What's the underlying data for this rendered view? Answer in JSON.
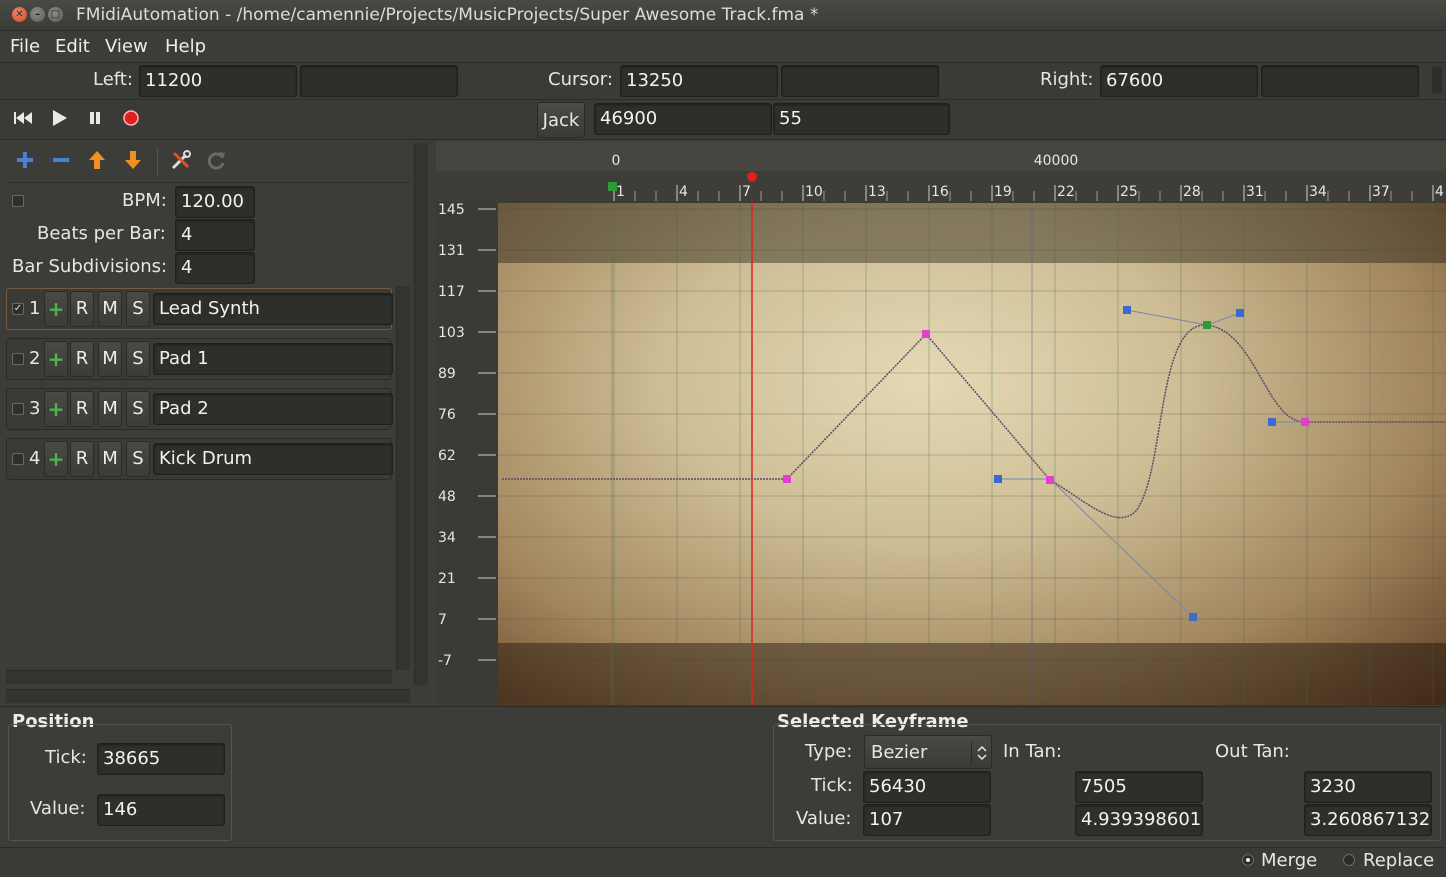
{
  "window": {
    "title": "FMidiAutomation - /home/camennie/Projects/MusicProjects/Super Awesome Track.fma *",
    "close_glyph": "✕",
    "min_glyph": "–",
    "max_glyph": "□"
  },
  "menu": [
    "File",
    "Edit",
    "View",
    "Help"
  ],
  "position_bar": {
    "left_label": "Left:",
    "left_value": "11200",
    "left_extra": "",
    "cursor_label": "Cursor:",
    "cursor_value": "13250",
    "cursor_extra": "",
    "right_label": "Right:",
    "right_value": "67600",
    "right_extra": ""
  },
  "transport": {
    "icons": [
      "rewind-icon",
      "play-icon",
      "pause-icon",
      "record-icon"
    ],
    "jack_label": "Jack",
    "jack_value1": "46900",
    "jack_value2": "55"
  },
  "toolbar_icons": [
    "add-icon",
    "remove-icon",
    "move-up-icon",
    "move-down-icon",
    "tools-icon",
    "redo-icon"
  ],
  "tempo": {
    "bpm_label": "BPM:",
    "bpm_value": "120.00",
    "beats_label": "Beats per Bar:",
    "beats_value": "4",
    "subdiv_label": "Bar Subdivisions:",
    "subdiv_value": "4"
  },
  "tracks": [
    {
      "num": "1",
      "r": "R",
      "m": "M",
      "s": "S",
      "name": "Lead Synth",
      "checked": true
    },
    {
      "num": "2",
      "r": "R",
      "m": "M",
      "s": "S",
      "name": "Pad 1",
      "checked": false
    },
    {
      "num": "3",
      "r": "R",
      "m": "M",
      "s": "S",
      "name": "Pad 2",
      "checked": false
    },
    {
      "num": "4",
      "r": "R",
      "m": "M",
      "s": "S",
      "name": "Kick Drum",
      "checked": false
    }
  ],
  "timeline": {
    "tick_labels_top": [
      "0",
      "40000"
    ],
    "bar_labels": [
      "1",
      "4",
      "7",
      "10",
      "13",
      "16",
      "19",
      "22",
      "25",
      "28",
      "31",
      "34",
      "37",
      "4"
    ],
    "value_labels": [
      "145",
      "131",
      "117",
      "103",
      "89",
      "76",
      "62",
      "48",
      "34",
      "21",
      "7",
      "-7"
    ]
  },
  "position_panel": {
    "title": "Position",
    "tick_label": "Tick:",
    "tick_value": "38665",
    "value_label": "Value:",
    "value_value": "146"
  },
  "keyframe_panel": {
    "title": "Selected Keyframe",
    "type_label": "Type:",
    "type_value": "Bezier",
    "in_tan_label": "In Tan:",
    "out_tan_label": "Out Tan:",
    "tick_label": "Tick:",
    "tick_value": "56430",
    "value_label": "Value:",
    "value_value": "107",
    "in_tick": "7505",
    "in_value": "4.939398601",
    "out_tick": "3230",
    "out_value": "3.260867132"
  },
  "status": {
    "merge_label": "Merge",
    "replace_label": "Replace",
    "selected_mode": "Merge"
  },
  "colors": {
    "cursor_line": "#e02020",
    "curve": "#5a4a6a",
    "key_magenta": "#e040d0",
    "key_blue": "#3a6ad0",
    "key_green": "#2a9a3a"
  }
}
